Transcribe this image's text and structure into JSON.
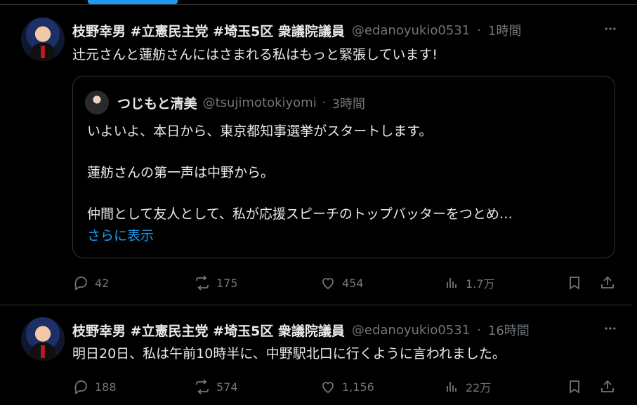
{
  "tweets": [
    {
      "author": {
        "name": "枝野幸男 #立憲民主党 #埼玉5区 衆議院議員",
        "handle": "@edanoyukio0531",
        "separator": "·",
        "time": "1時間"
      },
      "text": "辻元さんと蓮舫さんにはさまれる私はもっと緊張しています!",
      "quote": {
        "name": "つじもと清美",
        "handle": "@tsujimotokiyomi",
        "separator": "·",
        "time": "3時間",
        "lines": [
          "いよいよ、本日から、東京都知事選挙がスタートします。",
          "蓮舫さんの第一声は中野から。",
          "仲間として友人として、私が応援スピーチのトップバッターをつとめ…"
        ],
        "show_more": "さらに表示"
      },
      "stats": {
        "replies": "42",
        "reposts": "175",
        "likes": "454",
        "views": "1.7万"
      },
      "more_icon": "more-icon"
    },
    {
      "author": {
        "name": "枝野幸男 #立憲民主党 #埼玉5区 衆議院議員",
        "handle": "@edanoyukio0531",
        "separator": "·",
        "time": "16時間"
      },
      "text": "明日20日、私は午前10時半に、中野駅北口に行くように言われました。",
      "stats": {
        "replies": "188",
        "reposts": "574",
        "likes": "1,156",
        "views": "22万"
      },
      "more_icon": "more-icon"
    }
  ],
  "colors": {
    "background": "#000000",
    "text": "#e7e9ea",
    "muted": "#71767b",
    "accent": "#1d9bf0",
    "border": "#2f3336"
  }
}
